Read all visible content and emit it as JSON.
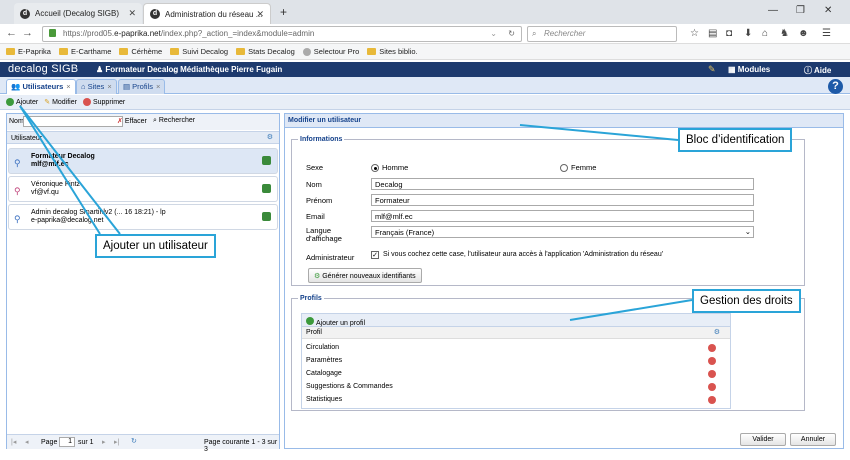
{
  "browser": {
    "tabs": [
      {
        "label": "Accueil (Decalog SIGB)"
      },
      {
        "label": "Administration du réseau ..."
      }
    ],
    "url_prefix": "https://prod05.",
    "url_host": "e-paprika.net",
    "url_rest": "/index.php?_action_=index&module=admin",
    "search_placeholder": "Rechercher",
    "bookmarks": [
      "E-Paprika",
      "E-Carthame",
      "Cérhème",
      "Suivi Decalog",
      "Stats Decalog",
      "Selectour Pro",
      "Sites biblio."
    ]
  },
  "app": {
    "logo": "decalog SIGB",
    "user": "Formateur Decalog",
    "library": "Médiathèque Pierre Fugain",
    "modules": "Modules",
    "help": "Aide",
    "tabs": [
      "Utilisateurs",
      "Sites",
      "Profils"
    ]
  },
  "toolbar": {
    "add": "Ajouter",
    "edit": "Modifier",
    "delete": "Supprimer"
  },
  "left": {
    "nom_label": "Nom",
    "clear": "Effacer",
    "search": "Rechercher",
    "column": "Utilisateur",
    "users": [
      {
        "name": "Formateur Decalog",
        "email": "mlf@mlf.ec"
      },
      {
        "name": "Véronique Fintz",
        "email": "vf@vf.qu"
      },
      {
        "name": "Admin decalog Smartinlv2 (... 16 18:21) - lp",
        "email": "e-paprika@decalog.net"
      }
    ],
    "pager": {
      "page_label": "Page",
      "page": "1",
      "of": "sur 1",
      "status": "Page courante 1 - 3 sur 3"
    }
  },
  "right": {
    "title": "Modifier un utilisateur",
    "info_legend": "Informations",
    "sexe_label": "Sexe",
    "homme": "Homme",
    "femme": "Femme",
    "nom_label": "Nom",
    "nom_value": "Decalog",
    "prenom_label": "Prénom",
    "prenom_value": "Formateur",
    "email_label": "Email",
    "email_value": "mlf@mlf.ec",
    "langue_label": "Langue d'affichage",
    "langue_value": "Français (France)",
    "admin_label": "Administrateur",
    "admin_text": "Si vous cochez cette case, l'utilisateur aura accès à l'application 'Administration du réseau'",
    "gen_button": "Générer nouveaux identifiants",
    "profils_legend": "Profils",
    "add_profile": "Ajouter un profil",
    "profile_col": "Profil",
    "profiles": [
      "Circulation",
      "Paramètres",
      "Catalogage",
      "Suggestions & Commandes",
      "Statistiques"
    ],
    "validate": "Valider",
    "cancel": "Annuler"
  },
  "callouts": {
    "identification": "Bloc d’identification",
    "add_user": "Ajouter un utilisateur",
    "rights": "Gestion des droits"
  },
  "colors": {
    "header": "#1d3a6e",
    "accent": "#2aa4d8",
    "panel_border": "#99bbe8"
  }
}
